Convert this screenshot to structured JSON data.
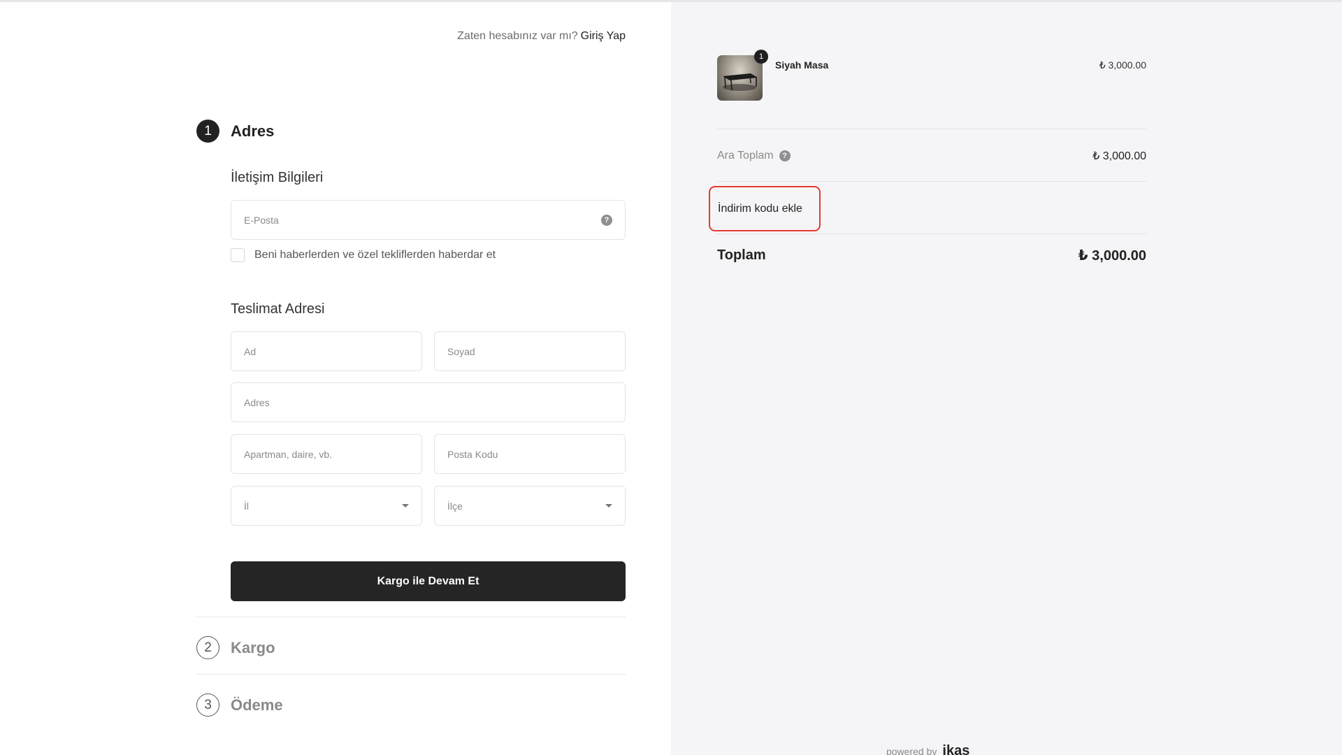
{
  "header": {
    "have_account": "Zaten hesabınız var mı?",
    "login_link": "Giriş Yap"
  },
  "steps": [
    {
      "number": "1",
      "title": "Adres",
      "state": "active"
    },
    {
      "number": "2",
      "title": "Kargo",
      "state": "inactive"
    },
    {
      "number": "3",
      "title": "Ödeme",
      "state": "inactive"
    }
  ],
  "contact": {
    "title": "İletişim Bilgileri",
    "email_placeholder": "E-Posta",
    "email_value": "",
    "help_glyph": "?",
    "newsletter_label": "Beni haberlerden ve özel tekliflerden haberdar et",
    "newsletter_checked": false
  },
  "shipping": {
    "title": "Teslimat Adresi",
    "first_name_placeholder": "Ad",
    "last_name_placeholder": "Soyad",
    "address_placeholder": "Adres",
    "apartment_placeholder": "Apartman, daire, vb.",
    "postal_placeholder": "Posta Kodu",
    "city_value": "İl",
    "district_value": "İlçe"
  },
  "continue_button": "Kargo ile Devam Et",
  "cart": {
    "items": [
      {
        "name": "Siyah Masa",
        "quantity": "1",
        "price": "₺ 3,000.00",
        "thumbnail_icon": "table-thumbnail"
      }
    ],
    "subtotal_label": "Ara Toplam",
    "subtotal_help_glyph": "?",
    "subtotal_value": "₺ 3,000.00",
    "discount_label": "İndirim kodu ekle",
    "total_label": "Toplam",
    "total_value": "₺ 3,000.00"
  },
  "footer": {
    "powered_text": "powered by",
    "brand": "ikas"
  },
  "colors": {
    "primary": "#252525",
    "right_panel_bg": "#f5f5f7",
    "highlight_border": "#e53a2f",
    "muted_text": "#8a8a8a"
  }
}
